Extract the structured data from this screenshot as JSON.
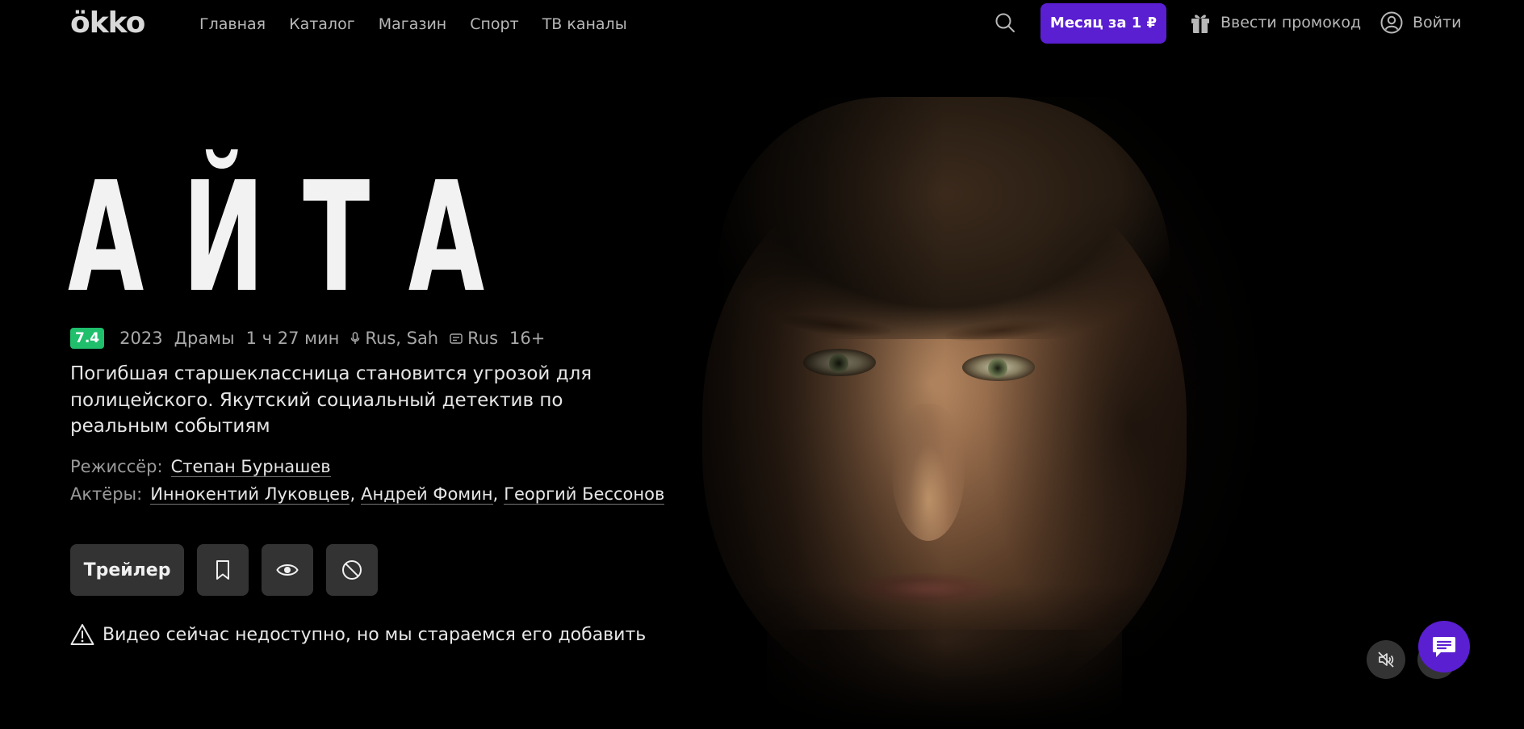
{
  "header": {
    "logo": "ökko",
    "nav": [
      "Главная",
      "Каталог",
      "Магазин",
      "Спорт",
      "ТВ каналы"
    ],
    "promo_button": "Месяц за 1 ₽",
    "promocode": "Ввести промокод",
    "login": "Войти"
  },
  "movie": {
    "title": "АЙТА",
    "rating": "7.4",
    "year": "2023",
    "genre": "Драмы",
    "duration": "1 ч 27 мин",
    "audio": "Rus, Sah",
    "subtitles": "Rus",
    "age": "16+",
    "description": "Погибшая старшеклассница становится угрозой для полицейского. Якутский социальный детектив по реальным событиям",
    "director_label": "Режиссёр:",
    "director": "Степан Бурнашев",
    "actors_label": "Актёры:",
    "actors": [
      "Иннокентий Луковцев",
      "Андрей Фомин",
      "Георгий Бессонов"
    ],
    "separator": ","
  },
  "actions": {
    "trailer": "Трейлер"
  },
  "notice": "Видео сейчас недоступно, но мы стараемся его добавить",
  "colors": {
    "accent": "#5a1fd1",
    "rating": "#1fbf6c",
    "button_bg": "#333333"
  },
  "icons": {
    "search": "search-icon",
    "gift": "gift-icon",
    "user": "user-icon",
    "mic": "microphone-icon",
    "subtitles": "subtitles-icon",
    "bookmark": "bookmark-icon",
    "eye": "eye-icon",
    "block": "block-icon",
    "warning": "warning-icon",
    "mute": "mute-icon",
    "chat": "chat-icon"
  }
}
